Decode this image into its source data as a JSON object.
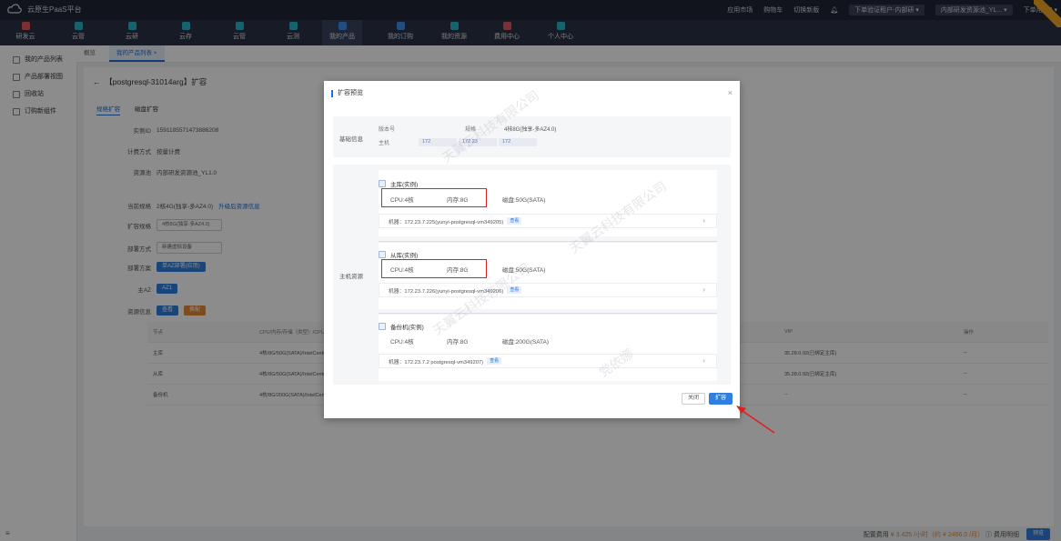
{
  "topbar": {
    "brand": "云原生PaaS平台",
    "links": [
      "应用市场",
      "购物车",
      "切换新版"
    ],
    "tenant": "下单验证租户-内部研 ▾",
    "resource_pool": "内部研发资源池_YL... ▾",
    "user": "下单用户3 ▾"
  },
  "nav": {
    "items": [
      "研发云",
      "云管",
      "云研",
      "云存",
      "云管",
      "云测",
      "我的产品",
      "我的订购",
      "我的资源",
      "费用中心",
      "个人中心"
    ],
    "active": "我的产品"
  },
  "sidebar": {
    "items": [
      "我的产品列表",
      "产品部署视图",
      "回收站",
      "订购新组件"
    ]
  },
  "tabs": [
    "概览",
    "我的产品列表 ×"
  ],
  "page": {
    "title": "【postgresql-31014arg】扩容",
    "subtabs": [
      "规格扩容",
      "磁盘扩容"
    ],
    "fields": [
      {
        "label": "实例ID",
        "value": "1591185571473886208"
      },
      {
        "label": "计费方式",
        "value": "按量计费"
      },
      {
        "label": "资源池",
        "value": "内部研发资源池_YL1.0"
      },
      {
        "label": "当前规格",
        "value": "2核4G(独享-多AZ4.0)"
      },
      {
        "label": "扩容规格",
        "value": "4核8G(独享-多AZ4.0)"
      },
      {
        "label": "部署方式",
        "value": "新建虚拟设备"
      },
      {
        "label": "部署方案",
        "value": "单AZ部署(应用)"
      },
      {
        "label": "主AZ",
        "value": "AZ1"
      },
      {
        "label": "资源信息",
        "value": "查看"
      }
    ],
    "current_spec_link": "升级后资源信息",
    "resource_btns": [
      "查看",
      "换配"
    ],
    "table_headers": [
      "节点",
      "CPU/内存/存储（类型）/CPU类型",
      "VIP",
      "操作"
    ],
    "table_rows": [
      {
        "node": "主库",
        "spec": "4核/8G/50G(SATA)/IntelCentos",
        "vip": "35.28.0.92(已绑定主库)",
        "op": "--"
      },
      {
        "node": "从库",
        "spec": "4核/8G/50G(SATA)/IntelCentos",
        "vip": "35.28.0.92(已绑定主库)",
        "op": "--"
      },
      {
        "node": "备份机",
        "spec": "4核/8G/200G(SATA)/IntelCentos",
        "vip": "--",
        "op": "--"
      }
    ]
  },
  "dialog": {
    "title": "扩容预览",
    "basic": {
      "label": "基础信息",
      "version_label": "版本号",
      "spec_label": "规格",
      "spec_value": "4核8G(独享-多AZ4.0)",
      "host_label": "主机",
      "ips": [
        "172",
        "172.23",
        "172"
      ]
    },
    "host": {
      "label": "主机资源",
      "nodes": [
        {
          "name": "主库(实例)",
          "cpu": "CPU:4核",
          "mem": "内存:8G",
          "disk": "磁盘:50G(SATA)",
          "machine": "机器：172.23.7.225(yunyi-postgresql-vm349205)",
          "tag": "查看"
        },
        {
          "name": "从库(实例)",
          "cpu": "CPU:4核",
          "mem": "内存:8G",
          "disk": "磁盘:50G(SATA)",
          "machine": "机器：172.23.7.226(yunyi-postgresql-vm349206)",
          "tag": "查看"
        },
        {
          "name": "备份机(实例)",
          "cpu": "CPU:4核",
          "mem": "内存:8G",
          "disk": "磁盘:200G(SATA)",
          "machine": "机器：172.23.7.2        postgresql-vm349207)",
          "tag": "查看"
        }
      ]
    },
    "cancel": "关闭",
    "confirm": "扩容"
  },
  "watermark": [
    "天翼云科技有限公司",
    "党依娜"
  ],
  "bottom": {
    "label": "配置费用",
    "price": "¥ 3.425 /小时（约 ¥ 2466.0 /月）",
    "detail": "费用明细",
    "submit": "预览"
  }
}
